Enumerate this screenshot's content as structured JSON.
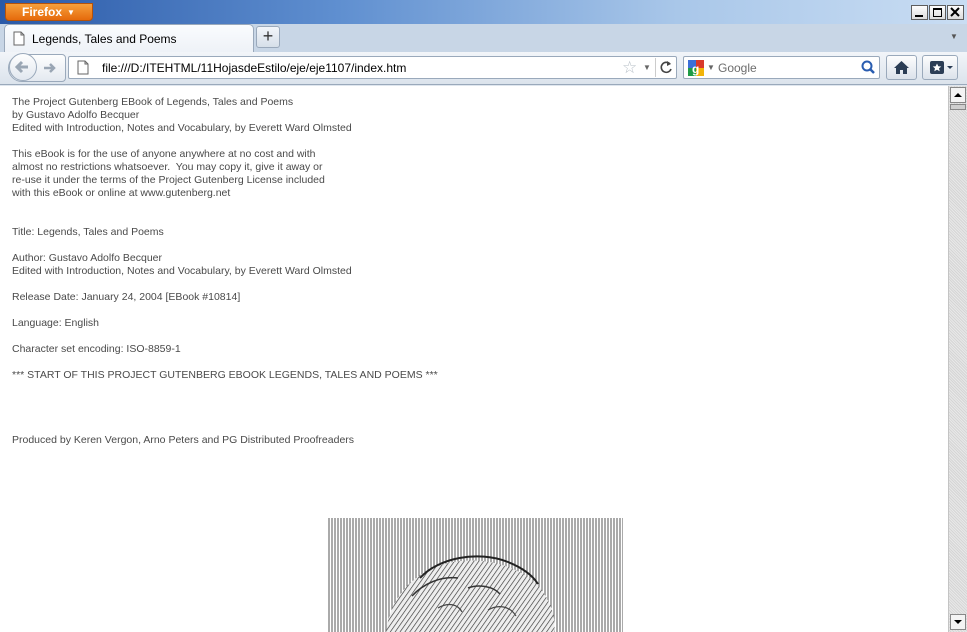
{
  "window": {
    "menu_button": "Firefox"
  },
  "tab": {
    "title": "Legends, Tales and Poems",
    "new_tab_label": "+"
  },
  "navbar": {
    "url": "file:///D:/ITEHTML/11HojasdeEstilo/eje/eje1107/index.htm",
    "search_placeholder": "Google"
  },
  "content": {
    "lines": [
      "The Project Gutenberg EBook of Legends, Tales and Poems",
      "by Gustavo Adolfo Becquer",
      "Edited with Introduction, Notes and Vocabulary, by Everett Ward Olmsted",
      "",
      "This eBook is for the use of anyone anywhere at no cost and with",
      "almost no restrictions whatsoever.  You may copy it, give it away or",
      "re-use it under the terms of the Project Gutenberg License included",
      "with this eBook or online at www.gutenberg.net",
      "",
      "",
      "Title: Legends, Tales and Poems",
      "",
      "Author: Gustavo Adolfo Becquer",
      "Edited with Introduction, Notes and Vocabulary, by Everett Ward Olmsted",
      "",
      "Release Date: January 24, 2004 [EBook #10814]",
      "",
      "Language: English",
      "",
      "Character set encoding: ISO-8859-1",
      "",
      "*** START OF THIS PROJECT GUTENBERG EBOOK LEGENDS, TALES AND POEMS ***",
      "",
      "",
      "",
      "",
      "Produced by Keren Vergon, Arno Peters and PG Distributed Proofreaders"
    ]
  },
  "colors": {
    "firefox_orange": "#e56a0b",
    "text": "#4a4a4a"
  }
}
